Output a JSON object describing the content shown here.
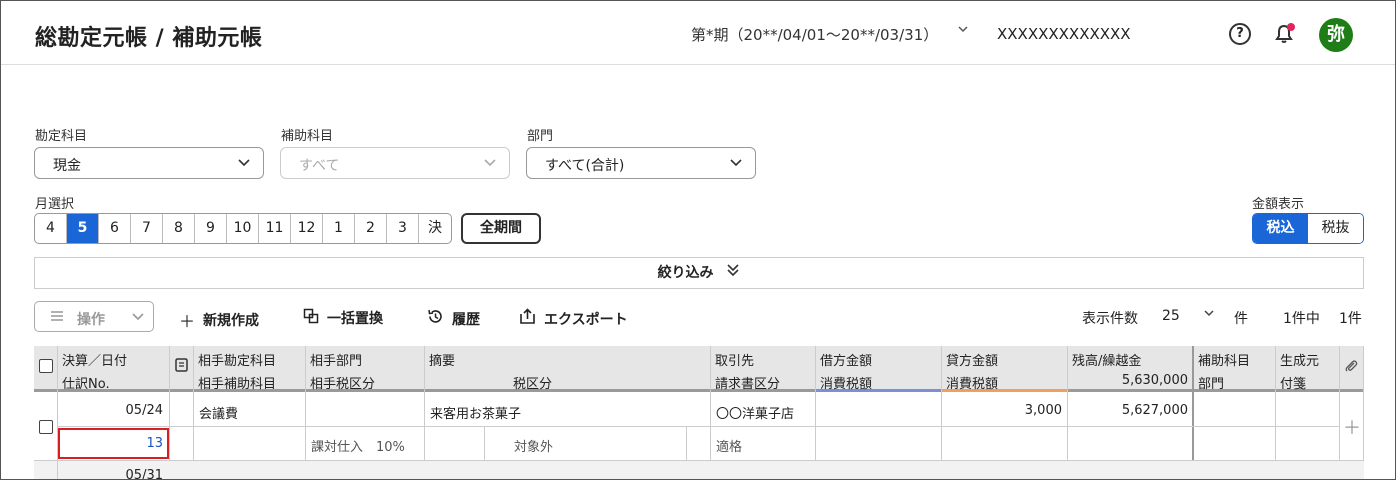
{
  "header": {
    "title": "総勘定元帳 / 補助元帳",
    "period": "第*期（20**/04/01〜20**/03/31）",
    "company": "XXXXXXXXXXXXX",
    "avatar": "弥"
  },
  "filters": {
    "account": {
      "label": "勘定科目",
      "value": "現金"
    },
    "sub_account": {
      "label": "補助科目",
      "value": "すべて"
    },
    "department": {
      "label": "部門",
      "value": "すべて(合計)"
    },
    "month_label": "月選択",
    "months": [
      "4",
      "5",
      "6",
      "7",
      "8",
      "9",
      "10",
      "11",
      "12",
      "1",
      "2",
      "3",
      "決"
    ],
    "active_month": "5",
    "all_period": "全期間",
    "amount_display_label": "金額表示",
    "tax_incl": "税込",
    "tax_excl": "税抜",
    "narrow": "絞り込み"
  },
  "toolbar": {
    "ops": "操作",
    "new": "新規作成",
    "bulk_replace": "一括置換",
    "history": "履歴",
    "export": "エクスポート",
    "per_page_label": "表示件数",
    "per_page": "25",
    "per_page_unit": "件",
    "count": "1件中",
    "count_shown": "1件"
  },
  "table": {
    "headers_top": [
      "決算／日付",
      "相手勘定科目",
      "相手部門",
      "摘要",
      "取引先",
      "借方金額",
      "貸方金額",
      "残高/繰越金",
      "補助科目",
      "生成元"
    ],
    "headers_bottom": [
      "仕訳No.",
      "相手補助科目",
      "相手税区分",
      "税区分",
      "請求書区分",
      "消費税額",
      "消費税額",
      "5,630,000",
      "部門",
      "付箋"
    ],
    "rows": [
      {
        "date": "05/24",
        "entry_no": "13",
        "account": "会議費",
        "department": "",
        "memo": "来客用お茶菓子",
        "partner": "〇〇洋菓子店",
        "debit": "",
        "credit": "3,000",
        "balance": "5,627,000",
        "tax_category": "課対仕入　10%",
        "tax_type": "対象外",
        "invoice": "適格"
      },
      {
        "date": "05/31"
      }
    ]
  },
  "colors": {
    "accent": "#1a66d6",
    "highlight": "#d81e1e",
    "debit_bar": "#7b8fd6",
    "credit_bar": "#f0a05a",
    "avatar": "#1e7d16"
  }
}
